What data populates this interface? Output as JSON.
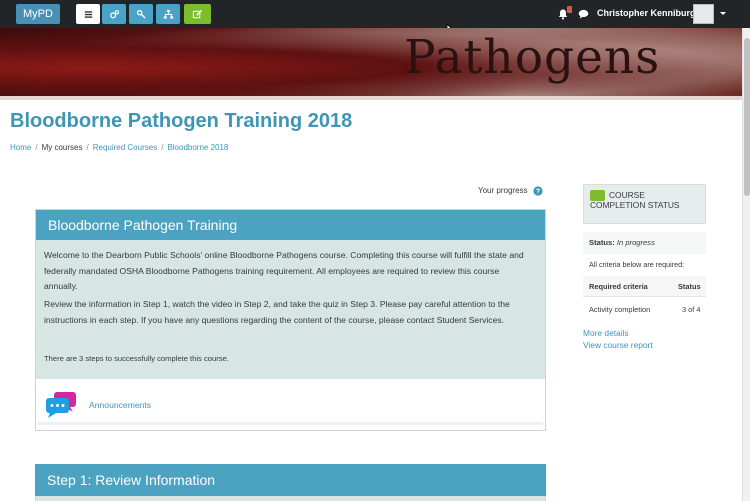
{
  "navbar": {
    "brand": "MyPD",
    "notification_count": "",
    "user_name": "Christopher Kenniburg",
    "icons": [
      "hamburger-icon",
      "cogs-icon",
      "wrench-icon",
      "sitemap-icon",
      "edit-icon",
      "bell-icon",
      "chat-icon"
    ],
    "colors": {
      "bar": "#212528",
      "brand": "#4b8fb7",
      "blue_button": "#4aa3c6",
      "green_button": "#7bbd2d",
      "badge": "#d9534f"
    }
  },
  "banner": {
    "title": "Pathogens"
  },
  "page": {
    "title": "Bloodborne Pathogen Training 2018",
    "breadcrumb": [
      "Home",
      "My courses",
      "Required Courses",
      "Bloodborne 2018"
    ],
    "your_progress": "Your progress"
  },
  "course": {
    "heading": "Bloodborne Pathogen Training",
    "para1": "Welcome to the Dearborn Public Schools' online Bloodborne Pathogens course.  Completing this course will fulfill the state and federally mandated OSHA Bloodborne Pathogens training requirement.  All employees are required to review this course annually.",
    "para2": "Review the information in Step 1, watch the video in Step 2, and take the quiz in Step 3.  Please pay careful attention to the instructions in each step.  If you have any questions regarding the content of the course, please contact Student Services.",
    "para3": "There are 3 steps to successfully complete this course.",
    "announcements": "Announcements",
    "accent_color": "#4ba2c1",
    "body_color": "#d7e5e3"
  },
  "step1": {
    "heading": "Step 1: Review Information"
  },
  "completion": {
    "title": "COURSE COMPLETION STATUS",
    "status_label": "Status:",
    "status_value": "In progress",
    "criteria_note": "All criteria below are required:",
    "col_criteria": "Required criteria",
    "col_status": "Status",
    "row_criteria": "Activity completion",
    "row_status": "3 of 4",
    "more_details": "More details",
    "view_report": "View course report"
  }
}
